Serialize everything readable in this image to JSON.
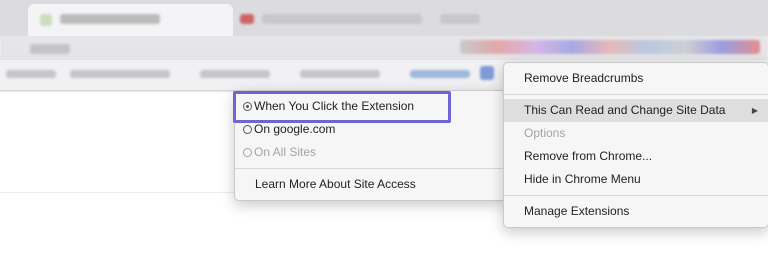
{
  "context_menu": {
    "items": [
      {
        "label": "Remove Breadcrumbs",
        "enabled": true
      },
      {
        "label": "This Can Read and Change Site Data",
        "enabled": true,
        "submenu": true,
        "highlighted": true
      },
      {
        "label": "Options",
        "enabled": false
      },
      {
        "label": "Remove from Chrome...",
        "enabled": true
      },
      {
        "label": "Hide in Chrome Menu",
        "enabled": true
      },
      {
        "label": "Manage Extensions",
        "enabled": true
      }
    ]
  },
  "site_access_submenu": {
    "options": [
      {
        "label": "When You Click the Extension",
        "selected": true,
        "enabled": true
      },
      {
        "label": "On google.com",
        "selected": false,
        "enabled": true
      },
      {
        "label": "On All Sites",
        "selected": false,
        "enabled": false
      }
    ],
    "learn_more": "Learn More About Site Access"
  },
  "colors": {
    "highlight_border": "#6e64d6",
    "menu_bg": "#f6f6f6"
  }
}
